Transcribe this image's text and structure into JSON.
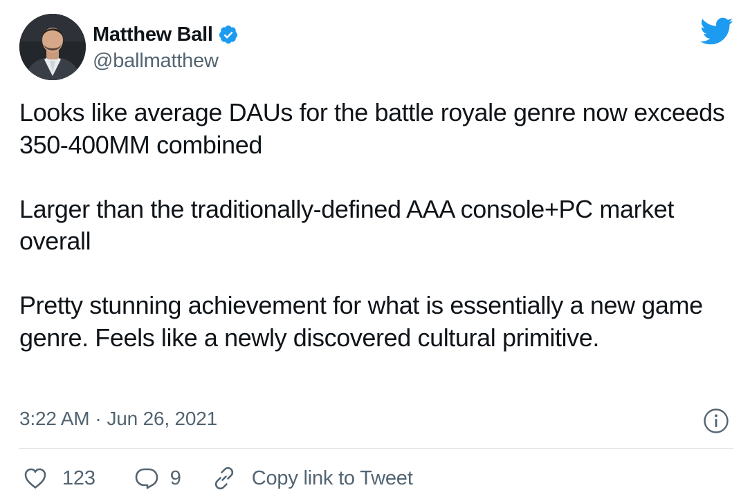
{
  "author": {
    "display_name": "Matthew Ball",
    "handle": "@ballmatthew",
    "verified": true
  },
  "tweet": {
    "paragraphs": [
      "Looks like average DAUs for the battle royale genre now exceeds 350-400MM combined",
      "Larger than the traditionally-defined AAA console+PC market overall",
      "Pretty stunning achievement for what is essentially a new game genre. Feels like a newly discovered cultural primitive."
    ],
    "time": "3:22 AM",
    "separator": "·",
    "date": "Jun 26, 2021"
  },
  "actions": {
    "like_count": "123",
    "reply_count": "9",
    "copy_link_label": "Copy link to Tweet"
  },
  "icons": {
    "brand": "twitter-bird-icon",
    "verified": "verified-badge-icon",
    "info": "info-icon",
    "like": "heart-icon",
    "reply": "speech-bubble-icon",
    "copy": "link-icon"
  },
  "colors": {
    "brand_blue": "#1d9bf0",
    "text_primary": "#0f1419",
    "text_secondary": "#536471",
    "divider": "#cfd9de"
  }
}
